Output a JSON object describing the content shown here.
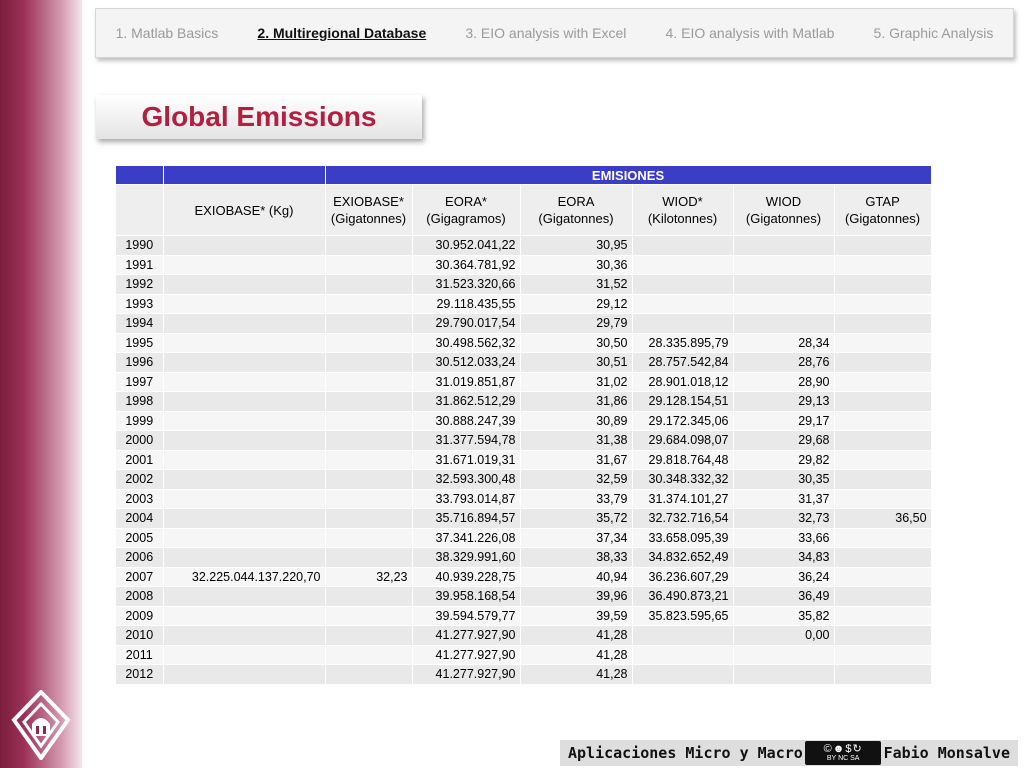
{
  "nav": {
    "tabs": [
      {
        "label": "1. Matlab Basics"
      },
      {
        "label": "2. Multiregional Database"
      },
      {
        "label": "3. EIO analysis with Excel"
      },
      {
        "label": "4. EIO analysis with Matlab"
      },
      {
        "label": "5. Graphic Analysis"
      }
    ],
    "active_index": 1
  },
  "page": {
    "title": "Global Emissions"
  },
  "table": {
    "group_header": "EMISIONES",
    "columns": [
      "EXIOBASE* (Kg)",
      "EXIOBASE* (Gigatonnes)",
      "EORA* (Gigagramos)",
      "EORA (Gigatonnes)",
      "WIOD* (Kilotonnes)",
      "WIOD (Gigatonnes)",
      "GTAP (Gigatonnes)"
    ],
    "rows": [
      [
        "1990",
        "",
        "",
        "30.952.041,22",
        "30,95",
        "",
        "",
        ""
      ],
      [
        "1991",
        "",
        "",
        "30.364.781,92",
        "30,36",
        "",
        "",
        ""
      ],
      [
        "1992",
        "",
        "",
        "31.523.320,66",
        "31,52",
        "",
        "",
        ""
      ],
      [
        "1993",
        "",
        "",
        "29.118.435,55",
        "29,12",
        "",
        "",
        ""
      ],
      [
        "1994",
        "",
        "",
        "29.790.017,54",
        "29,79",
        "",
        "",
        ""
      ],
      [
        "1995",
        "",
        "",
        "30.498.562,32",
        "30,50",
        "28.335.895,79",
        "28,34",
        ""
      ],
      [
        "1996",
        "",
        "",
        "30.512.033,24",
        "30,51",
        "28.757.542,84",
        "28,76",
        ""
      ],
      [
        "1997",
        "",
        "",
        "31.019.851,87",
        "31,02",
        "28.901.018,12",
        "28,90",
        ""
      ],
      [
        "1998",
        "",
        "",
        "31.862.512,29",
        "31,86",
        "29.128.154,51",
        "29,13",
        ""
      ],
      [
        "1999",
        "",
        "",
        "30.888.247,39",
        "30,89",
        "29.172.345,06",
        "29,17",
        ""
      ],
      [
        "2000",
        "",
        "",
        "31.377.594,78",
        "31,38",
        "29.684.098,07",
        "29,68",
        ""
      ],
      [
        "2001",
        "",
        "",
        "31.671.019,31",
        "31,67",
        "29.818.764,48",
        "29,82",
        ""
      ],
      [
        "2002",
        "",
        "",
        "32.593.300,48",
        "32,59",
        "30.348.332,32",
        "30,35",
        ""
      ],
      [
        "2003",
        "",
        "",
        "33.793.014,87",
        "33,79",
        "31.374.101,27",
        "31,37",
        ""
      ],
      [
        "2004",
        "",
        "",
        "35.716.894,57",
        "35,72",
        "32.732.716,54",
        "32,73",
        "36,50"
      ],
      [
        "2005",
        "",
        "",
        "37.341.226,08",
        "37,34",
        "33.658.095,39",
        "33,66",
        ""
      ],
      [
        "2006",
        "",
        "",
        "38.329.991,60",
        "38,33",
        "34.832.652,49",
        "34,83",
        ""
      ],
      [
        "2007",
        "32.225.044.137.220,70",
        "32,23",
        "40.939.228,75",
        "40,94",
        "36.236.607,29",
        "36,24",
        ""
      ],
      [
        "2008",
        "",
        "",
        "39.958.168,54",
        "39,96",
        "36.490.873,21",
        "36,49",
        ""
      ],
      [
        "2009",
        "",
        "",
        "39.594.579,77",
        "39,59",
        "35.823.595,65",
        "35,82",
        ""
      ],
      [
        "2010",
        "",
        "",
        "41.277.927,90",
        "41,28",
        "",
        "0,00",
        ""
      ],
      [
        "2011",
        "",
        "",
        "41.277.927,90",
        "41,28",
        "",
        "",
        ""
      ],
      [
        "2012",
        "",
        "",
        "41.277.927,90",
        "41,28",
        "",
        "",
        ""
      ]
    ]
  },
  "footer": {
    "left_text": "Aplicaciones Micro y Macro",
    "right_text": "Fabio Monsalve",
    "license_icon": "cc-by-nc-sa-icon",
    "license_labels": [
      "BY",
      "NC",
      "SA"
    ]
  },
  "logo": {
    "icon": "university-logo-icon"
  },
  "colors": {
    "accent_red": "#b0203f",
    "header_blue": "#3a3ec7",
    "sidebar_maroon": "#7a1e3c"
  }
}
